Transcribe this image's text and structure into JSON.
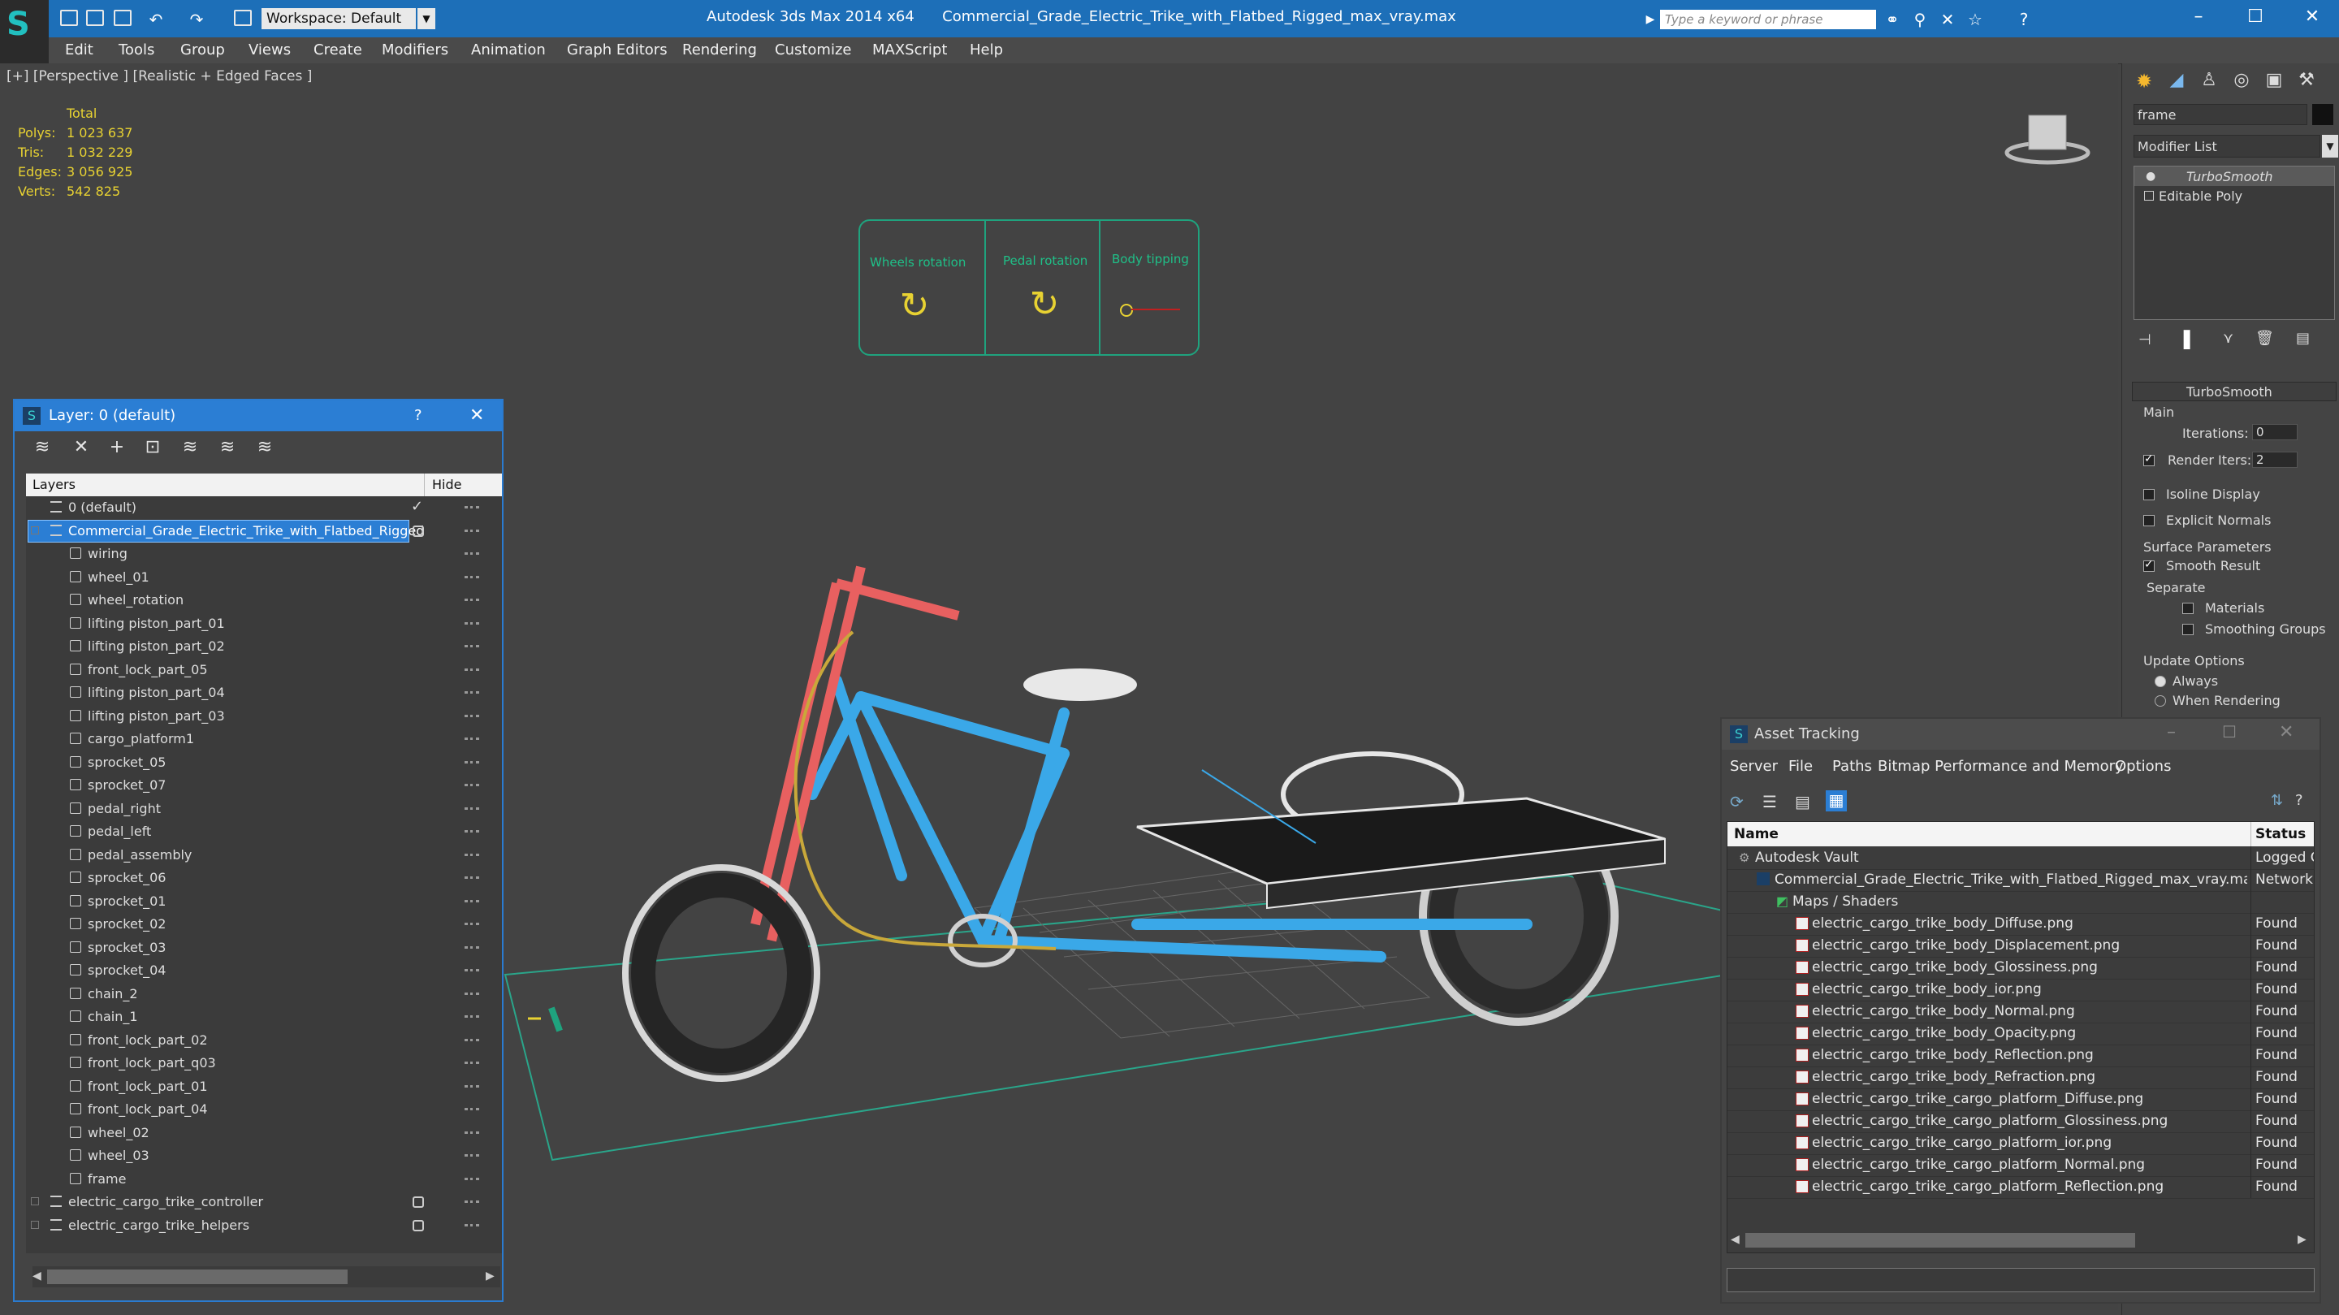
{
  "titlebar": {
    "app": "Autodesk 3ds Max  2014 x64",
    "file": "Commercial_Grade_Electric_Trike_with_Flatbed_Rigged_max_vray.max",
    "workspace": "Workspace: Default",
    "search_placeholder": "Type a keyword or phrase"
  },
  "menubar": [
    "Edit",
    "Tools",
    "Group",
    "Views",
    "Create",
    "Modifiers",
    "Animation",
    "Graph Editors",
    "Rendering",
    "Customize",
    "MAXScript",
    "Help"
  ],
  "viewport": {
    "label": "[+] [Perspective ] [Realistic + Edged Faces ]",
    "stats": {
      "total_label": "Total",
      "polys_label": "Polys:",
      "polys": "1 023 637",
      "tris_label": "Tris:",
      "tris": "1 032 229",
      "edges_label": "Edges:",
      "edges": "3 056 925",
      "verts_label": "Verts:",
      "verts": "542 825"
    },
    "rig": {
      "wheels": "Wheels rotation",
      "pedal": "Pedal rotation",
      "body": "Body tipping"
    },
    "colors": {
      "wire_blue": "#3aa8e8",
      "wire_red": "#e86060",
      "rig_green": "#1fa37e"
    }
  },
  "cmdpanel": {
    "object_name": "frame",
    "modifier_list": "Modifier List",
    "stack": [
      "TurboSmooth",
      "Editable Poly"
    ],
    "rollout_title": "TurboSmooth",
    "main_label": "Main",
    "iterations_label": "Iterations:",
    "iterations": "0",
    "render_iters_label": "Render Iters:",
    "render_iters": "2",
    "isoline": "Isoline Display",
    "explicit": "Explicit Normals",
    "surface_params": "Surface Parameters",
    "smooth_result": "Smooth Result",
    "separate": "Separate",
    "materials": "Materials",
    "smoothing_groups": "Smoothing Groups",
    "update_options": "Update Options",
    "always": "Always",
    "when_rendering": "When Rendering"
  },
  "layerwin": {
    "title": "Layer: 0 (default)",
    "help": "?",
    "col_layers": "Layers",
    "col_hide": "Hide",
    "layers": [
      {
        "name": "0 (default)",
        "level": 0,
        "active": true
      },
      {
        "name": "Commercial_Grade_Electric_Trike_with_Flatbed_Rigged",
        "level": 0,
        "selected": true
      },
      {
        "name": "wiring",
        "level": 1
      },
      {
        "name": "wheel_01",
        "level": 1
      },
      {
        "name": "wheel_rotation",
        "level": 1
      },
      {
        "name": "lifting piston_part_01",
        "level": 1
      },
      {
        "name": "lifting piston_part_02",
        "level": 1
      },
      {
        "name": "front_lock_part_05",
        "level": 1
      },
      {
        "name": "lifting piston_part_04",
        "level": 1
      },
      {
        "name": "lifting piston_part_03",
        "level": 1
      },
      {
        "name": "cargo_platform1",
        "level": 1
      },
      {
        "name": "sprocket_05",
        "level": 1
      },
      {
        "name": "sprocket_07",
        "level": 1
      },
      {
        "name": "pedal_right",
        "level": 1
      },
      {
        "name": "pedal_left",
        "level": 1
      },
      {
        "name": "pedal_assembly",
        "level": 1
      },
      {
        "name": "sprocket_06",
        "level": 1
      },
      {
        "name": "sprocket_01",
        "level": 1
      },
      {
        "name": "sprocket_02",
        "level": 1
      },
      {
        "name": "sprocket_03",
        "level": 1
      },
      {
        "name": "sprocket_04",
        "level": 1
      },
      {
        "name": "chain_2",
        "level": 1
      },
      {
        "name": "chain_1",
        "level": 1
      },
      {
        "name": "front_lock_part_02",
        "level": 1
      },
      {
        "name": "front_lock_part_q03",
        "level": 1
      },
      {
        "name": "front_lock_part_01",
        "level": 1
      },
      {
        "name": "front_lock_part_04",
        "level": 1
      },
      {
        "name": "wheel_02",
        "level": 1
      },
      {
        "name": "wheel_03",
        "level": 1
      },
      {
        "name": "frame",
        "level": 1
      },
      {
        "name": "electric_cargo_trike_controller",
        "level": 0
      },
      {
        "name": "electric_cargo_trike_helpers",
        "level": 0
      }
    ]
  },
  "assetwin": {
    "title": "Asset Tracking",
    "menu": [
      "Server",
      "File",
      "Paths",
      "Bitmap Performance and Memory",
      "Options"
    ],
    "col_name": "Name",
    "col_status": "Status",
    "rows": [
      {
        "name": "Autodesk Vault",
        "status": "Logged C",
        "level": 0
      },
      {
        "name": "Commercial_Grade_Electric_Trike_with_Flatbed_Rigged_max_vray.max",
        "status": "Network I",
        "level": 1
      },
      {
        "name": "Maps / Shaders",
        "status": "",
        "level": 2
      },
      {
        "name": "electric_cargo_trike_body_Diffuse.png",
        "status": "Found",
        "level": 3
      },
      {
        "name": "electric_cargo_trike_body_Displacement.png",
        "status": "Found",
        "level": 3
      },
      {
        "name": "electric_cargo_trike_body_Glossiness.png",
        "status": "Found",
        "level": 3
      },
      {
        "name": "electric_cargo_trike_body_ior.png",
        "status": "Found",
        "level": 3
      },
      {
        "name": "electric_cargo_trike_body_Normal.png",
        "status": "Found",
        "level": 3
      },
      {
        "name": "electric_cargo_trike_body_Opacity.png",
        "status": "Found",
        "level": 3
      },
      {
        "name": "electric_cargo_trike_body_Reflection.png",
        "status": "Found",
        "level": 3
      },
      {
        "name": "electric_cargo_trike_body_Refraction.png",
        "status": "Found",
        "level": 3
      },
      {
        "name": "electric_cargo_trike_cargo_platform_Diffuse.png",
        "status": "Found",
        "level": 3
      },
      {
        "name": "electric_cargo_trike_cargo_platform_Glossiness.png",
        "status": "Found",
        "level": 3
      },
      {
        "name": "electric_cargo_trike_cargo_platform_ior.png",
        "status": "Found",
        "level": 3
      },
      {
        "name": "electric_cargo_trike_cargo_platform_Normal.png",
        "status": "Found",
        "level": 3
      },
      {
        "name": "electric_cargo_trike_cargo_platform_Reflection.png",
        "status": "Found",
        "level": 3
      }
    ]
  }
}
